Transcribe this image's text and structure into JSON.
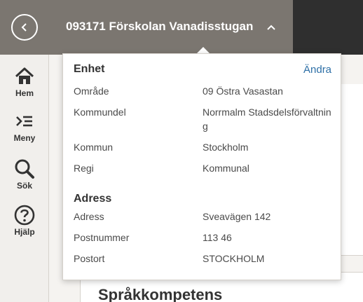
{
  "header": {
    "title": "093171 Förskolan Vanadisstugan"
  },
  "sidebar": {
    "items": [
      {
        "label": "Hem",
        "icon": "home-icon"
      },
      {
        "label": "Meny",
        "icon": "menu-icon"
      },
      {
        "label": "Sök",
        "icon": "search-icon"
      },
      {
        "label": "Hjälp",
        "icon": "help-icon"
      }
    ]
  },
  "main": {
    "section_title": "Språkkompetens"
  },
  "popover": {
    "unit_heading": "Enhet",
    "edit_link": "Ändra",
    "unit_rows": [
      {
        "label": "Område",
        "value": "09 Östra Vasastan"
      },
      {
        "label": "Kommundel",
        "value": "Norrmalm Stadsdelsförvaltning"
      },
      {
        "label": "Kommun",
        "value": "Stockholm"
      },
      {
        "label": "Regi",
        "value": "Kommunal"
      }
    ],
    "address_heading": "Adress",
    "address_rows": [
      {
        "label": "Adress",
        "value": "Sveavägen 142"
      },
      {
        "label": "Postnummer",
        "value": "113 46"
      },
      {
        "label": "Postort",
        "value": "STOCKHOLM"
      }
    ]
  },
  "colors": {
    "header_bg": "#7b7670",
    "header_dark": "#2f2f2f",
    "link": "#2d6fa6"
  }
}
